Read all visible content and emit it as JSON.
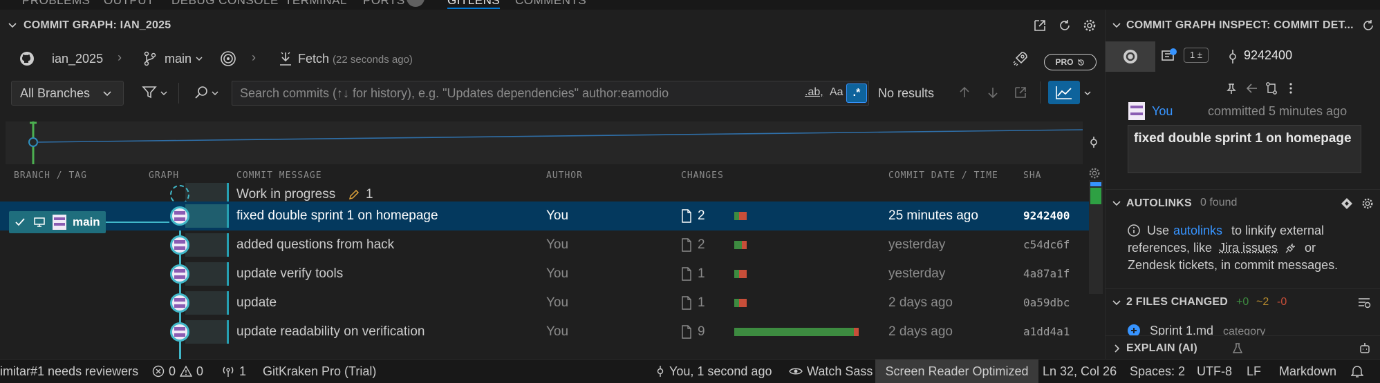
{
  "panel_tabs": [
    {
      "label": "PROBLEMS",
      "active": false
    },
    {
      "label": "OUTPUT",
      "active": false
    },
    {
      "label": "DEBUG CONSOLE",
      "active": false
    },
    {
      "label": "TERMINAL",
      "active": false
    },
    {
      "label": "PORTS",
      "active": false
    },
    {
      "label": "GITLENS",
      "active": true
    },
    {
      "label": "COMMENTS",
      "active": false
    }
  ],
  "graph": {
    "title": "COMMIT GRAPH: IAN_2025",
    "repo": "ian_2025",
    "branch": "main",
    "fetch_label": "Fetch",
    "fetch_time": "(22 seconds ago)",
    "pro_badge": "PRO",
    "branch_filter": "All Branches",
    "search_placeholder": "Search commits (↑↓ for history), e.g. \"Updates dependencies\" author:eamodio",
    "search_regex_label": ".ab,",
    "search_case_label": "Aa",
    "search_regex_toggle": ".*",
    "search_results": "No results",
    "columns": {
      "branch_tag": "BRANCH / TAG",
      "graph": "GRAPH",
      "message": "COMMIT MESSAGE",
      "author": "AUTHOR",
      "changes": "CHANGES",
      "date": "COMMIT DATE / TIME",
      "sha": "SHA"
    },
    "wip": {
      "label": "Work in progress",
      "count": "1"
    },
    "branch_label": "main",
    "commits": [
      {
        "message": "fixed double sprint 1 on homepage",
        "author": "You",
        "files": "2",
        "date": "25 minutes ago",
        "sha": "9242400",
        "added": 0.4,
        "deleted": 0.6
      },
      {
        "message": "added questions from hack",
        "author": "You",
        "files": "2",
        "date": "yesterday",
        "sha": "c54dc6f",
        "added": 0.6,
        "deleted": 0.4
      },
      {
        "message": "update verify tools",
        "author": "You",
        "files": "1",
        "date": "yesterday",
        "sha": "4a87a1f",
        "added": 0.4,
        "deleted": 0.6
      },
      {
        "message": "update",
        "author": "You",
        "files": "1",
        "date": "2 days ago",
        "sha": "0a59dbc",
        "added": 0.4,
        "deleted": 0.6
      },
      {
        "message": "update readability on verification",
        "author": "You",
        "files": "9",
        "date": "2 days ago",
        "sha": "a1dd4a1",
        "added": 0.96,
        "deleted": 0.04
      }
    ]
  },
  "inspect": {
    "title": "COMMIT GRAPH INSPECT: COMMIT DET...",
    "file_count_badge": "1 ±",
    "sha": "9242400",
    "author": "You",
    "committed": "committed 5 minutes ago",
    "commit_message": "fixed double sprint 1 on homepage",
    "autolinks": {
      "title": "AUTOLINKS",
      "found": "0 found",
      "text1": "Use",
      "link1": "autolinks",
      "text2": "to linkify external",
      "text3": "references, like",
      "link2": "Jira issues",
      "text4": "or",
      "text5": "Zendesk tickets, in commit messages."
    },
    "files_changed": {
      "title": "2 FILES CHANGED",
      "added": "+0",
      "modified": "~2",
      "deleted": "-0",
      "first_file": "Sprint 1.md",
      "first_file_dir": "category"
    },
    "explain": {
      "title": "EXPLAIN (AI)"
    }
  },
  "status_bar": {
    "pr": "imitar#1 needs reviewers",
    "errors": "0",
    "warnings": "0",
    "ports": "1",
    "gitkraken": "GitKraken Pro (Trial)",
    "blame": "You, 1 second ago",
    "watch": "Watch Sass",
    "screen_reader": "Screen Reader Optimized",
    "position": "Ln 32, Col 26",
    "spaces": "Spaces: 2",
    "encoding": "UTF-8",
    "eol": "LF",
    "language": "Markdown"
  },
  "colors": {
    "accent": "#0078d4",
    "selection": "#04395e",
    "graph_line": "#41b8c9",
    "added": "#3d8b40",
    "deleted": "#c74e39",
    "link": "#3794ff"
  }
}
